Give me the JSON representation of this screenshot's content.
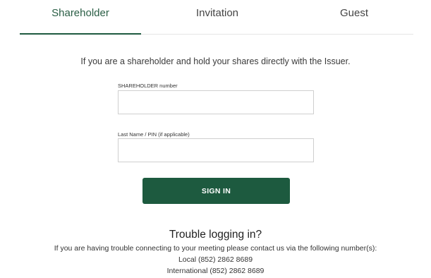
{
  "tabs": [
    {
      "label": "Shareholder",
      "active": true
    },
    {
      "label": "Invitation",
      "active": false
    },
    {
      "label": "Guest",
      "active": false
    }
  ],
  "colors": {
    "accent": "#1d5a3f",
    "active_tab_text": "#2a5e45"
  },
  "form": {
    "intro": "If you are a shareholder and hold your shares directly with the Issuer.",
    "shareholder_label": "SHAREHOLDER number",
    "shareholder_value": "",
    "lastname_label": "Last Name / PIN (if applicable)",
    "lastname_value": "",
    "signin_label": "SIGN IN"
  },
  "help": {
    "title": "Trouble logging in?",
    "text": "If you are having trouble connecting to your meeting please contact us via the following number(s):",
    "local": "Local (852) 2862 8689",
    "international": "International (852) 2862 8689"
  }
}
